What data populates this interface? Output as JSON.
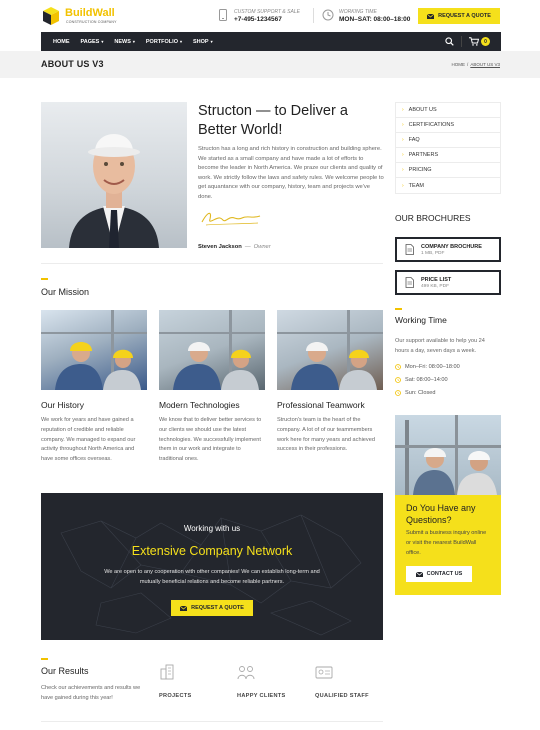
{
  "header": {
    "logo_name": "BuildWall",
    "logo_tagline": "CONSTRUCTION COMPANY",
    "support_label": "CUSTOM SUPPORT & SALE",
    "support_phone": "+7-495-1234567",
    "hours_label": "WORKING TIME",
    "hours_value": "MON–SAT: 08:00–18:00",
    "quote_button": "REQUEST A QUOTE"
  },
  "nav": {
    "items": [
      {
        "label": "HOME",
        "dropdown": false
      },
      {
        "label": "PAGES",
        "dropdown": true
      },
      {
        "label": "NEWS",
        "dropdown": true
      },
      {
        "label": "PORTFOLIO",
        "dropdown": true
      },
      {
        "label": "SHOP",
        "dropdown": true
      }
    ],
    "cart_count": "0"
  },
  "page_title": {
    "title": "ABOUT US V3",
    "breadcrumb_home": "HOME",
    "breadcrumb_sep": "/",
    "breadcrumb_current": "ABOUT US V3"
  },
  "intro": {
    "heading": "Structon — to Deliver a Better World!",
    "text": "Structon has a long and rich history in construction and building sphere. We started as a small company and have made a lot of efforts to become the leader in North America. We praze our clients and quality of work. We strictly follow the laws and safety rules. We welcome people to get aquantance with our company, history, team and projects we've done.",
    "author_name": "Steven Jackson",
    "author_sep": "—",
    "author_role": "Owner"
  },
  "mission": {
    "title": "Our Mission",
    "cards": [
      {
        "title": "Our History",
        "text": "We work for years and have gained a reputation of credible and reliable company. We managed to expand our activity throughout North America and have some offices overseas."
      },
      {
        "title": "Modern Technologies",
        "text": "We know that to deliver better services to our clients we should use the latest technologies. We successfully implement them in our work and integrate to traditional ones."
      },
      {
        "title": "Professional Teamwork",
        "text": "Structon's team is the heart of the company. A lot of of our teammembers work here for many years and achieved success in their professions."
      }
    ]
  },
  "network": {
    "subtitle": "Working with us",
    "title": "Extensive Company Network",
    "text": "We are open to any cooperation with other companies! We can establish long-term and mutually beneficial relations and become reliable partners.",
    "button": "REQUEST A QUOTE"
  },
  "results": {
    "title": "Our Results",
    "text": "Check our achievements and results we have gained during this year!",
    "items": [
      {
        "label": "PROJECTS",
        "icon": "building-icon"
      },
      {
        "label": "HAPPY CLIENTS",
        "icon": "people-icon"
      },
      {
        "label": "QUALIFIED STAFF",
        "icon": "id-card-icon"
      }
    ]
  },
  "sidebar": {
    "menu": [
      "ABOUT US",
      "CERTIFICATIONS",
      "FAQ",
      "PARTNERS",
      "PRICING",
      "TEAM"
    ],
    "brochures_title": "OUR BROCHURES",
    "brochures": [
      {
        "name": "COMPANY BROCHURE",
        "meta": "1 MB, PDF"
      },
      {
        "name": "PRICE LIST",
        "meta": "499 KB, PDF"
      }
    ],
    "working_title": "Working Time",
    "working_text": "Our support available to help you 24 hours a day, seven days a week.",
    "hours": [
      "Mon–Fri: 08:00–18:00",
      "Sat: 08:00–14:00",
      "Sun: Closed"
    ],
    "cta_title": "Do You Have any Questions?",
    "cta_text": "Submit a business inquiry online or visit the nearest BuildWall office.",
    "cta_button": "CONTACT US"
  },
  "colors": {
    "accent": "#f5e01b",
    "dark": "#23262d",
    "gold": "#f2c200"
  }
}
